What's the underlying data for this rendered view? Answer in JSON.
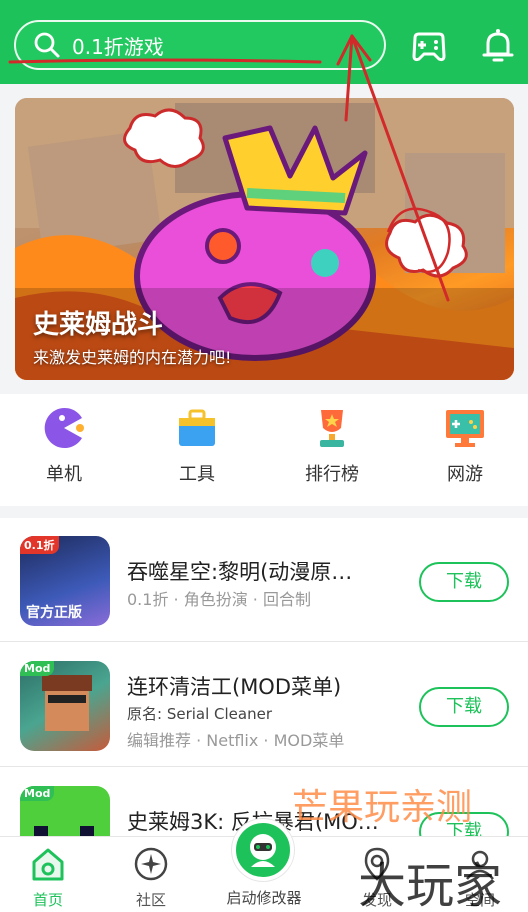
{
  "header": {
    "search_placeholder": "0.1折游戏",
    "search_icon": "search-icon",
    "gamepad_icon": "gamepad-icon",
    "bell_icon": "bell-icon",
    "brand_color": "#1ec25a"
  },
  "banner": {
    "title": "史莱姆战斗",
    "subtitle": "来激发史莱姆的内在潜力吧!"
  },
  "categories": [
    {
      "label": "单机",
      "icon": "pacman-icon"
    },
    {
      "label": "工具",
      "icon": "toolbox-icon"
    },
    {
      "label": "排行榜",
      "icon": "trophy-icon"
    },
    {
      "label": "网游",
      "icon": "network-game-icon"
    }
  ],
  "games": [
    {
      "name": "吞噬星空:黎明(动漫原…",
      "tags": "0.1折 · 角色扮演 · 回合制",
      "badge": "0.1折",
      "thumb_text": "官方正版",
      "button": "下载"
    },
    {
      "name": "连环清洁工(MOD菜单)",
      "original": "原名: Serial Cleaner",
      "tags": "编辑推荐 · Netflix · MOD菜单",
      "badge": "Mod",
      "button": "下载"
    },
    {
      "name": "史莱姆3K: 反抗暴君(MO…",
      "badge": "Mod",
      "button": "下载"
    }
  ],
  "nav": {
    "home": "首页",
    "community": "社区",
    "launcher": "启动修改器",
    "discover": "发现",
    "space": "空间"
  },
  "watermarks": {
    "top": "芒果玩亲测",
    "bottom": "大玩家"
  }
}
